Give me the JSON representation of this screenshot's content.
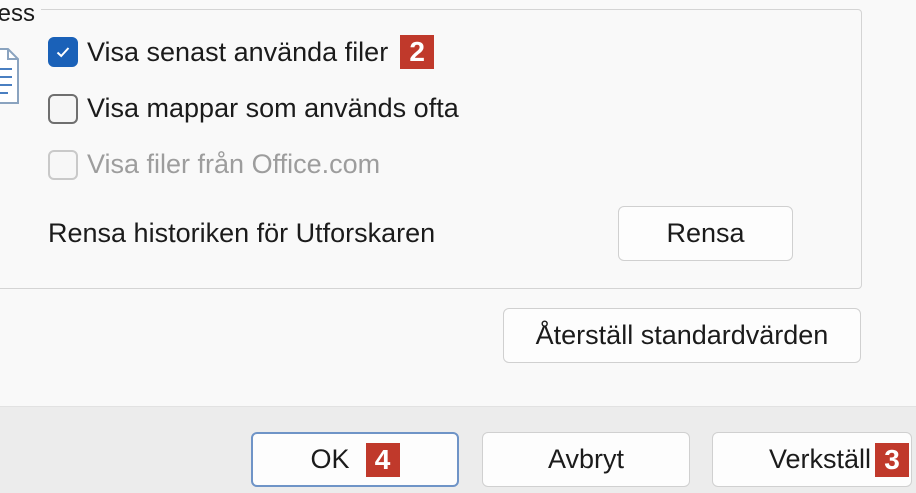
{
  "group": {
    "legend": "tess"
  },
  "checkboxes": [
    {
      "label": "Visa senast använda filer",
      "checked": true,
      "disabled": false,
      "badge": "2"
    },
    {
      "label": "Visa mappar som används ofta",
      "checked": false,
      "disabled": false
    },
    {
      "label": "Visa filer från Office.com",
      "checked": false,
      "disabled": true
    }
  ],
  "history": {
    "label": "Rensa historiken för Utforskaren",
    "clear_button": "Rensa"
  },
  "restore_button": "Återställ standardvärden",
  "footer": {
    "ok": "OK",
    "ok_badge": "4",
    "cancel": "Avbryt",
    "apply": "Verkställ",
    "apply_badge": "3"
  },
  "colors": {
    "accent": "#1a61b8",
    "badge": "#c0392b"
  },
  "icons": {
    "privacy": "document-icon",
    "check": "checkmark-icon"
  }
}
